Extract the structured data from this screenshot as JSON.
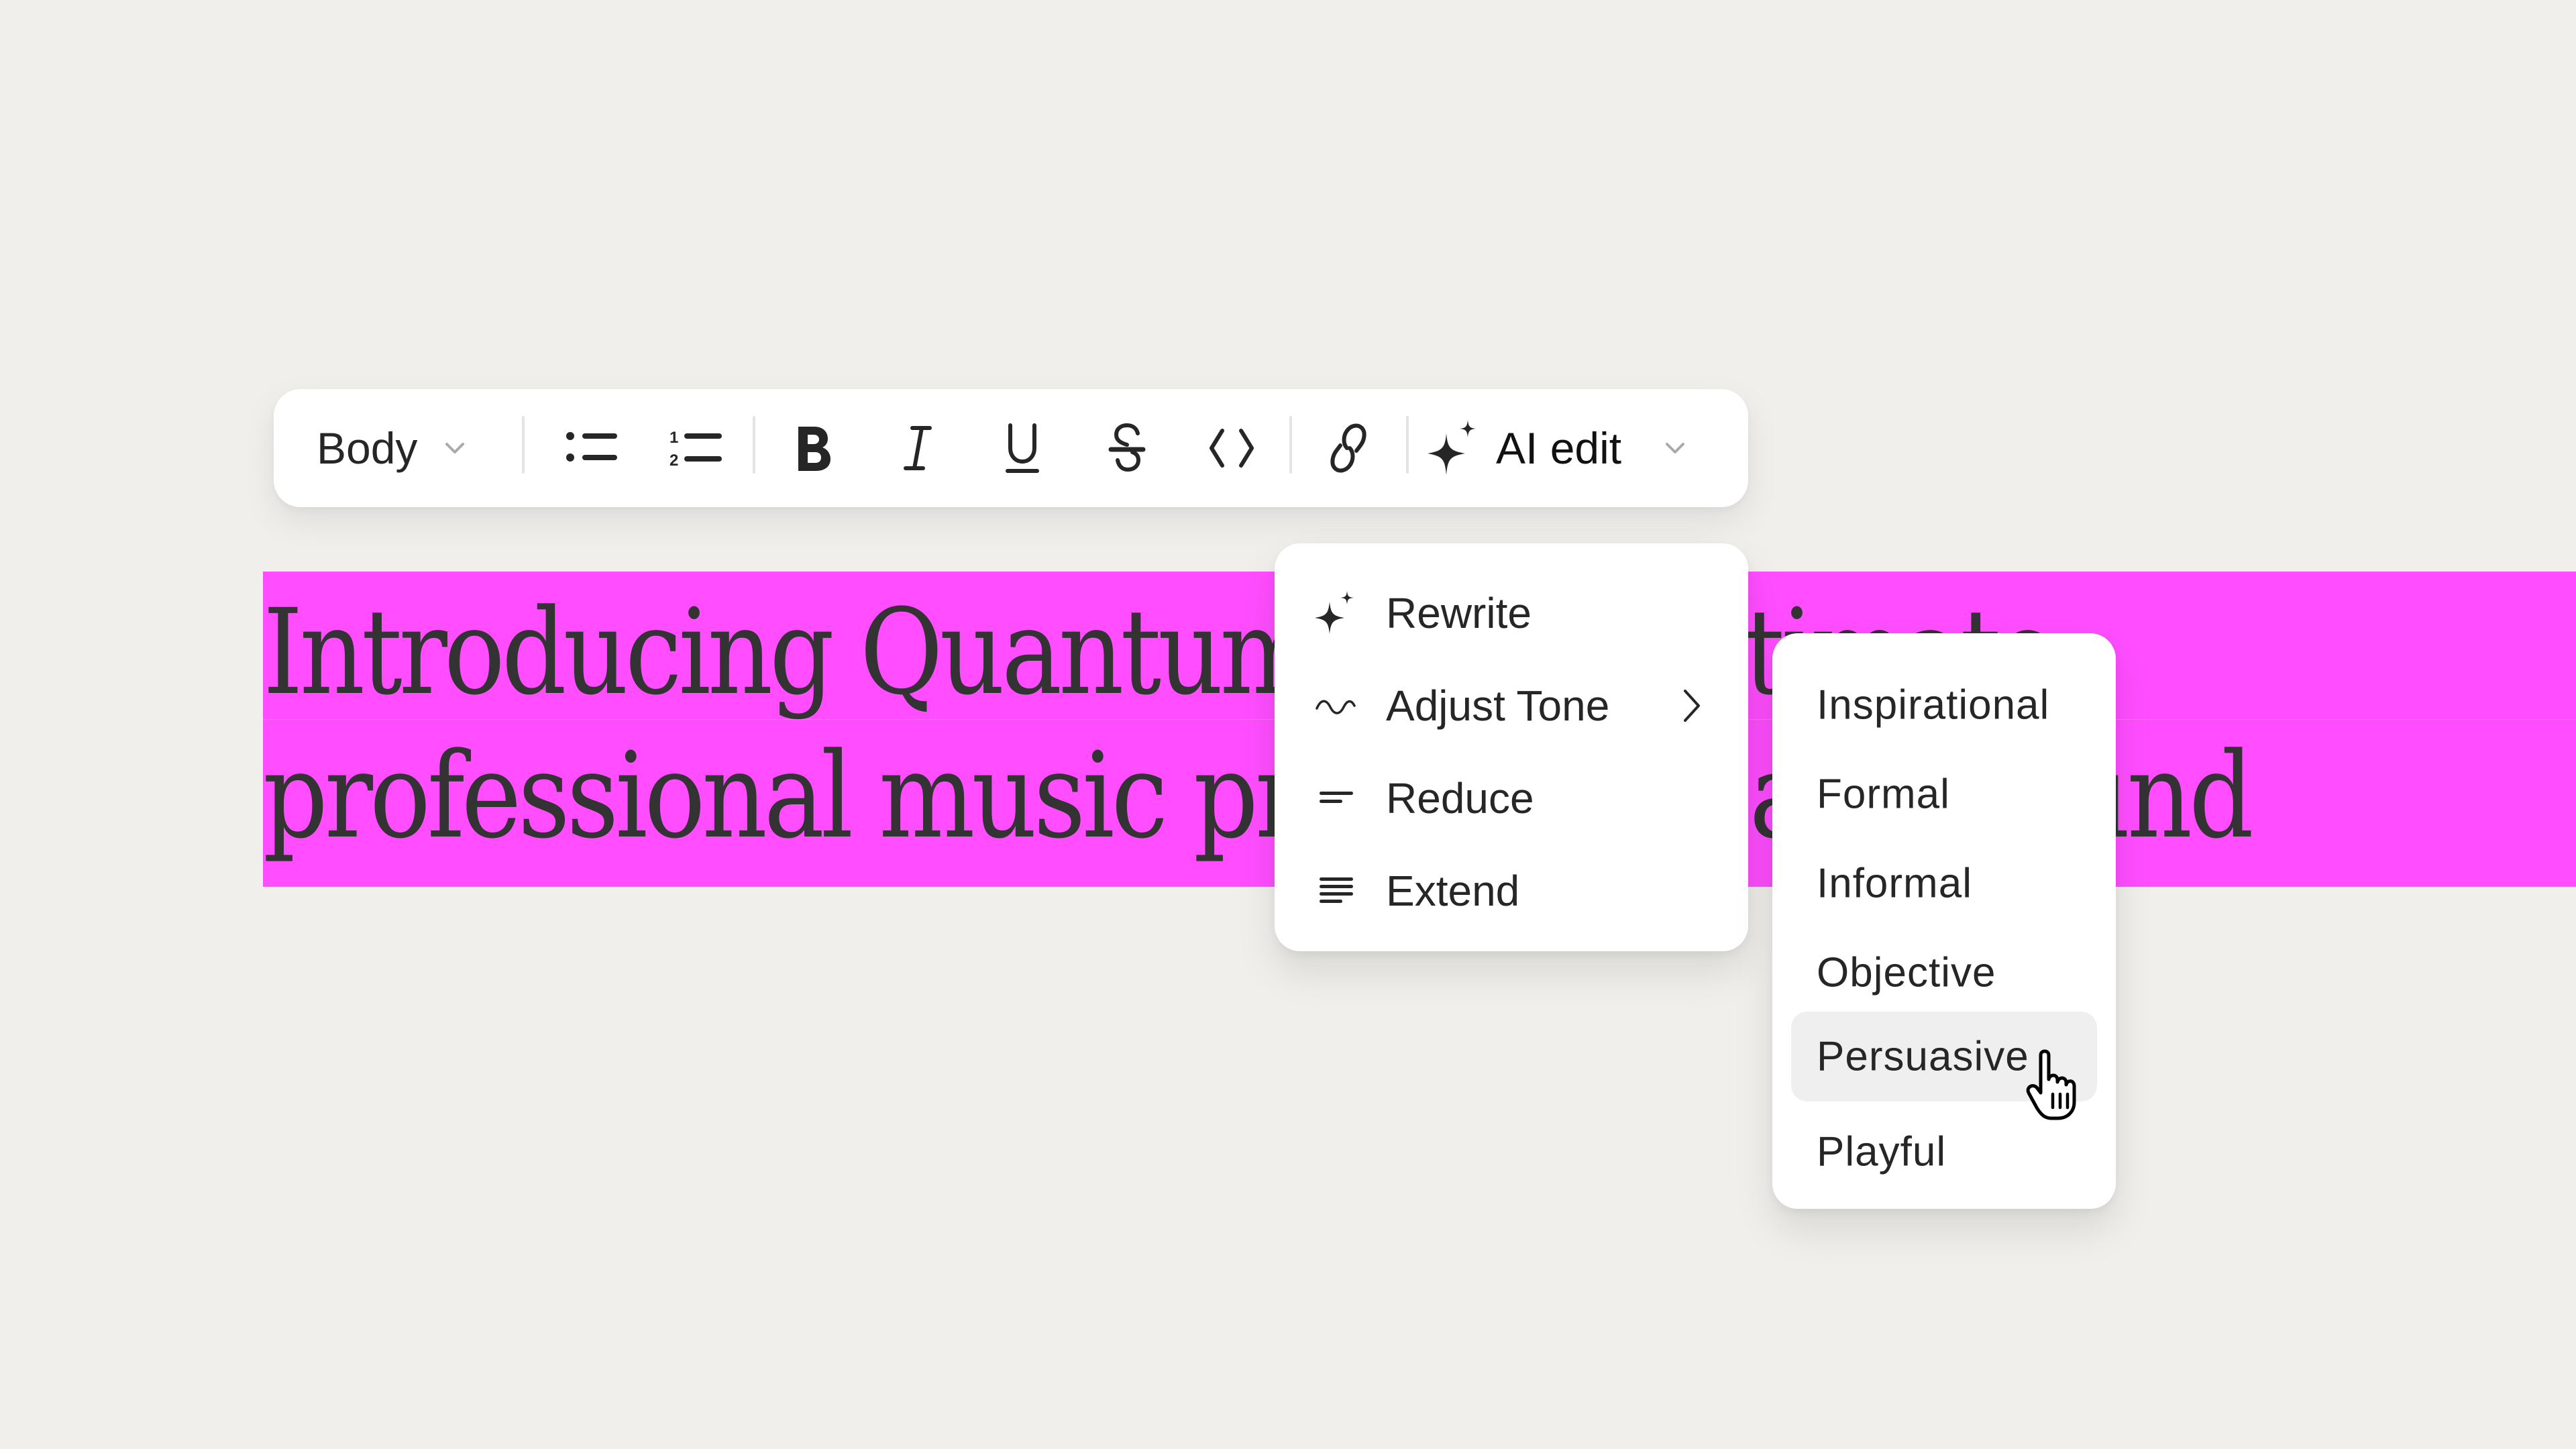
{
  "document": {
    "line1": "Introducing Quantum — the ultimate",
    "line2": "professional music production and sound",
    "highlight_color": "#FF4DFF",
    "text_color": "#333333"
  },
  "toolbar": {
    "style_select": {
      "value": "Body",
      "icon": "chevron-down-icon"
    },
    "buttons": [
      {
        "name": "bulleted-list",
        "icon": "bulleted-list-icon",
        "label": "Bulleted list"
      },
      {
        "name": "numbered-list",
        "icon": "numbered-list-icon",
        "label": "Numbered list"
      },
      {
        "name": "bold",
        "icon": "bold-icon",
        "label": "Bold"
      },
      {
        "name": "italic",
        "icon": "italic-icon",
        "label": "Italic"
      },
      {
        "name": "underline",
        "icon": "underline-icon",
        "label": "Underline"
      },
      {
        "name": "strikethrough",
        "icon": "strikethrough-icon",
        "label": "Strikethrough"
      },
      {
        "name": "code",
        "icon": "code-icon",
        "label": "Code"
      },
      {
        "name": "link",
        "icon": "link-icon",
        "label": "Link"
      }
    ],
    "ai_edit": {
      "label": "AI edit",
      "icon": "sparkle-icon",
      "caret": "chevron-down-icon"
    }
  },
  "ai_menu": {
    "items": [
      {
        "label": "Rewrite",
        "icon": "sparkle-icon"
      },
      {
        "label": "Adjust Tone",
        "icon": "wave-icon",
        "submenu": true
      },
      {
        "label": "Reduce",
        "icon": "reduce-lines-icon"
      },
      {
        "label": "Extend",
        "icon": "extend-lines-icon"
      }
    ]
  },
  "tone_submenu": {
    "items": [
      {
        "label": "Inspirational"
      },
      {
        "label": "Formal"
      },
      {
        "label": "Informal"
      },
      {
        "label": "Objective"
      },
      {
        "label": "Persuasive",
        "hovered": true
      },
      {
        "label": "Playful"
      }
    ]
  },
  "colors": {
    "background": "#F0EFEC",
    "surface": "#FFFFFF",
    "hover": "#EFEFEF",
    "text": "#262626",
    "muted_icon": "#AAAAAA"
  }
}
